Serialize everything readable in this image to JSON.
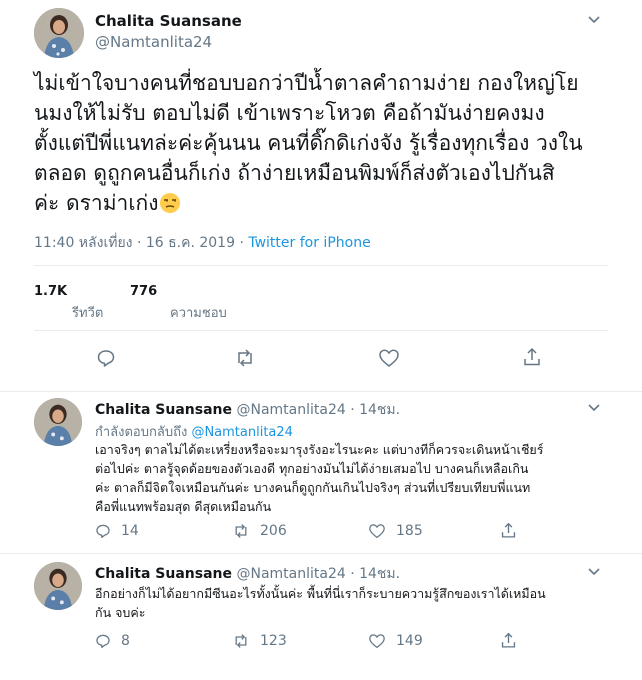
{
  "main": {
    "name": "Chalita Suansane",
    "handle": "@Namtanlita24",
    "text": "ไม่เข้าใจบางคนที่ชอบบอกว่าปีน้ำตาลคำถามง่าย กองใหญ่โย\nนมงให้ไม่รับ ตอบไม่ดี เข้าเพราะโหวต คือถ้ามันง่ายคงมง\nตั้งแต่ปีพี่แนทล่ะค่ะคุ้นนน คนที่ดิ๊กดิเก่งจัง รู้เรื่องทุกเรื่อง วงใน\nตลอด ดูถูกคนอื่นก็เก่ง ถ้าง่ายเหมือนพิมพ์ก็ส่งตัวเองไปกันสิ\nค่ะ ดราม่าเก่ง",
    "emoji": "unamused-face-emoji",
    "timestamp": "11:40 หลังเที่ยง · 16 ธ.ค. 2019 · ",
    "source": "Twitter for iPhone",
    "retweets_count": "1.7K",
    "retweets_label": "รีทวีต",
    "likes_count": "776",
    "likes_label": "ความชอบ",
    "actions": [
      "reply-icon",
      "retweet-icon",
      "like-icon",
      "share-icon"
    ]
  },
  "replies": [
    {
      "name": "Chalita Suansane",
      "handle_time": " @Namtanlita24 · 14ชม.",
      "replying_prefix": "กำลังตอบกลับถึง ",
      "replying_to": "@Namtanlita24",
      "text": "เอาจริงๆ ตาลไม่ได้ตะเหรี่ยงหรือจะมารุงรังอะไรนะคะ แต่บางทีก็ควรจะเดินหน้าเชียร์\nต่อไปค่ะ ตาลรู้จุดด้อยของตัวเองดี ทุกอย่างมันไม่ได้ง่ายเสมอไป บางคนก็เหลือเกิน\nค่ะ ตาลก็มีจิตใจเหมือนกันค่ะ บางคนก็ดูถูกกันเกินไปจริงๆ ส่วนที่เปรียบเทียบพี่แนท\nคือพี่แนทพร้อมสุด ดีสุดเหมือนกัน",
      "reply_count": "14",
      "retweet_count": "206",
      "like_count": "185"
    },
    {
      "name": "Chalita Suansane",
      "handle_time": " @Namtanlita24 · 14ชม.",
      "text": "อีกอย่างก็ไม่ได้อยากมีซีนอะไรทั้งนั้นค่ะ พื้นที่นี่เราก็ระบายความรู้สึกของเราได้เหมือน\nกัน จบค่ะ",
      "reply_count": "8",
      "retweet_count": "123",
      "like_count": "149"
    }
  ],
  "colors": {
    "text": "#14171a",
    "secondary": "#657786",
    "link": "#1b95e0",
    "divider": "#e6ecf0"
  }
}
